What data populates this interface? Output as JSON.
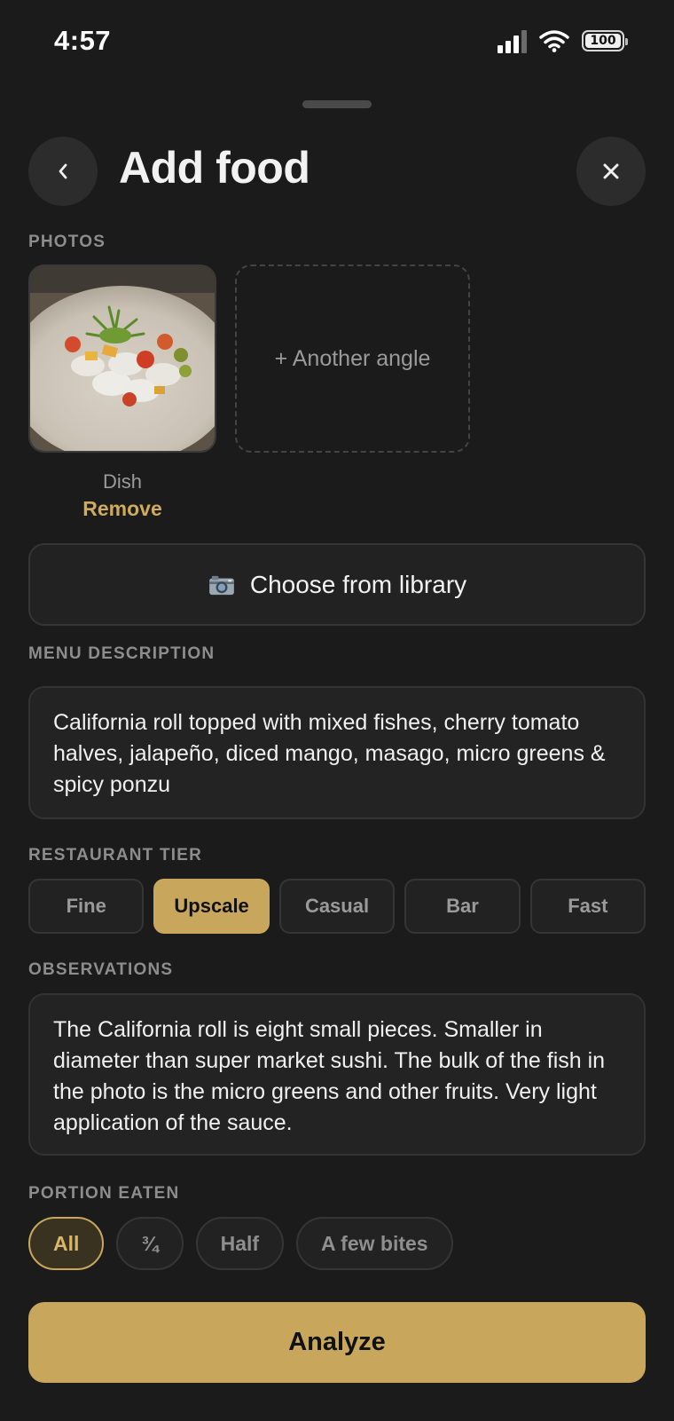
{
  "status": {
    "time": "4:57",
    "battery": "100"
  },
  "header": {
    "title": "Add food"
  },
  "photos": {
    "label": "PHOTOS",
    "items": [
      {
        "caption": "Dish",
        "remove_label": "Remove"
      }
    ],
    "add_label": "+ Another angle"
  },
  "library": {
    "label": "Choose from library",
    "icon": "camera-icon"
  },
  "menu_description": {
    "label": "MENU DESCRIPTION",
    "value": "California roll topped with mixed fishes, cherry tomato halves, jalapeño, diced mango, masago, micro greens & spicy ponzu"
  },
  "restaurant_tier": {
    "label": "RESTAURANT TIER",
    "options": [
      "Fine",
      "Upscale",
      "Casual",
      "Bar",
      "Fast"
    ],
    "selected": "Upscale"
  },
  "observations": {
    "label": "OBSERVATIONS",
    "value": "The California roll is eight small pieces. Smaller in diameter than super market sushi. The bulk of the fish in the photo is the micro greens and other fruits. Very light application of the sauce."
  },
  "portion_eaten": {
    "label": "PORTION EATEN",
    "options": [
      "All",
      "¾",
      "Half",
      "A few bites"
    ],
    "selected": "All"
  },
  "analyze": {
    "label": "Analyze"
  },
  "colors": {
    "accent": "#c8a75d",
    "background": "#1b1b1b",
    "surface": "#232323"
  }
}
